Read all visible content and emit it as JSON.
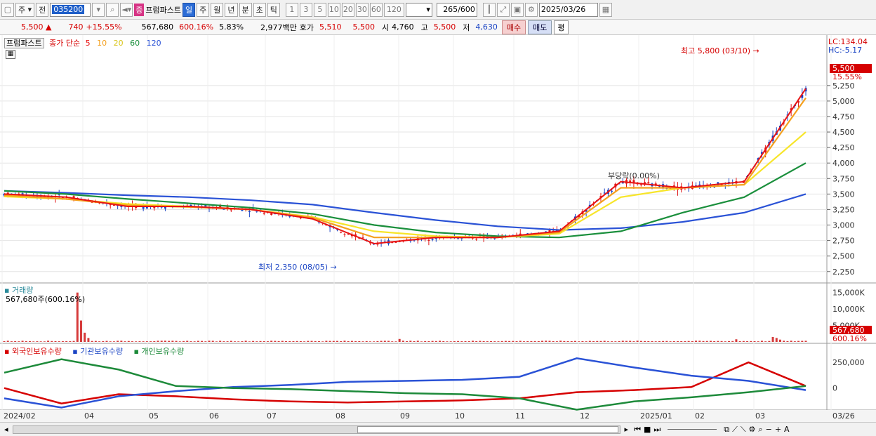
{
  "toolbar": {
    "period_mode": "주",
    "prev_label": "전",
    "stock_code": "035200",
    "badge": "증",
    "stock_name": "프럼파스트",
    "periods": [
      "일",
      "주",
      "월",
      "년",
      "분",
      "초",
      "틱"
    ],
    "active_period": "일",
    "intervals": [
      "1",
      "3",
      "5",
      "10",
      "20",
      "30",
      "60",
      "120"
    ],
    "count": "265",
    "count_max": "/600",
    "date": "2025/03/26"
  },
  "quote": {
    "price": "5,500",
    "change": "740",
    "change_pct": "+15.55%",
    "volume": "567,680",
    "vol_ratio": "600.16%",
    "turnover": "5.83%",
    "amount": "2,977백만",
    "bid_label": "호가",
    "bid1": "5,510",
    "bid2": "5,500",
    "open_label": "시",
    "open": "4,760",
    "high_label": "고",
    "high": "5,500",
    "low_label": "저",
    "low": "4,630",
    "buy_label": "매수",
    "sell_label": "매도",
    "avg_label": "평"
  },
  "price_panel": {
    "name_tag": "프럼파스트",
    "ma_title": "종가 단순",
    "ma_periods": [
      "5",
      "10",
      "20",
      "60",
      "120"
    ],
    "ma_colors": [
      "#e81313",
      "#f4a01e",
      "#f7e52a",
      "#1a8f3c",
      "#2a52d6"
    ],
    "lc": "LC:134.04",
    "hc": "HC:-5.17",
    "high_note": "최고 5,800 (03/10)",
    "low_note": "최저 2,350 (08/05)",
    "mid_note": "부당락(0.00%)",
    "last_price": "5,500",
    "last_pct": "15.55%",
    "y_ticks": [
      "5,250",
      "5,000",
      "4,750",
      "4,500",
      "4,250",
      "4,000",
      "3,750",
      "3,500",
      "3,250",
      "3,000",
      "2,750",
      "2,500",
      "2,250"
    ]
  },
  "volume_panel": {
    "title": "거래량",
    "info": "567,680주(600.16%)",
    "y_ticks": [
      "15,000K",
      "10,000K",
      "5,000K"
    ],
    "last": "567,680",
    "last_pct": "600.16%"
  },
  "holding_panel": {
    "series": [
      {
        "name": "외국인보유수량",
        "color": "#d60000"
      },
      {
        "name": "기관보유수량",
        "color": "#2a52d6"
      },
      {
        "name": "개인보유수량",
        "color": "#1d8a3a"
      }
    ],
    "y_ticks": [
      "250,000",
      "0"
    ]
  },
  "x_axis": {
    "labels": [
      "2024/02",
      "04",
      "05",
      "06",
      "07",
      "08",
      "09",
      "10",
      "11",
      "12",
      "2025/01",
      "02",
      "03",
      "03/26"
    ]
  },
  "chart_data": {
    "type": "line",
    "title": "",
    "x": [
      "2024/02",
      "03",
      "04",
      "05",
      "06",
      "07",
      "08",
      "09",
      "10",
      "11",
      "12",
      "2025/01",
      "02",
      "03"
    ],
    "series": [
      {
        "name": "5",
        "values": [
          3500,
          3450,
          3300,
          3300,
          3250,
          3100,
          2700,
          2800,
          2800,
          2900,
          3700,
          3600,
          3700,
          5200
        ]
      },
      {
        "name": "10",
        "values": [
          3480,
          3420,
          3320,
          3290,
          3250,
          3120,
          2800,
          2800,
          2800,
          2880,
          3600,
          3600,
          3650,
          5050
        ]
      },
      {
        "name": "20",
        "values": [
          3460,
          3420,
          3340,
          3300,
          3250,
          3130,
          2900,
          2820,
          2800,
          2860,
          3450,
          3600,
          3650,
          4500
        ]
      },
      {
        "name": "60",
        "values": [
          3550,
          3500,
          3420,
          3350,
          3280,
          3180,
          3000,
          2880,
          2820,
          2800,
          2900,
          3200,
          3450,
          4000
        ]
      },
      {
        "name": "120",
        "values": [
          3550,
          3520,
          3480,
          3450,
          3400,
          3330,
          3200,
          3080,
          2980,
          2920,
          2950,
          3050,
          3200,
          3500
        ]
      }
    ],
    "ylim": [
      2250,
      5800
    ]
  }
}
